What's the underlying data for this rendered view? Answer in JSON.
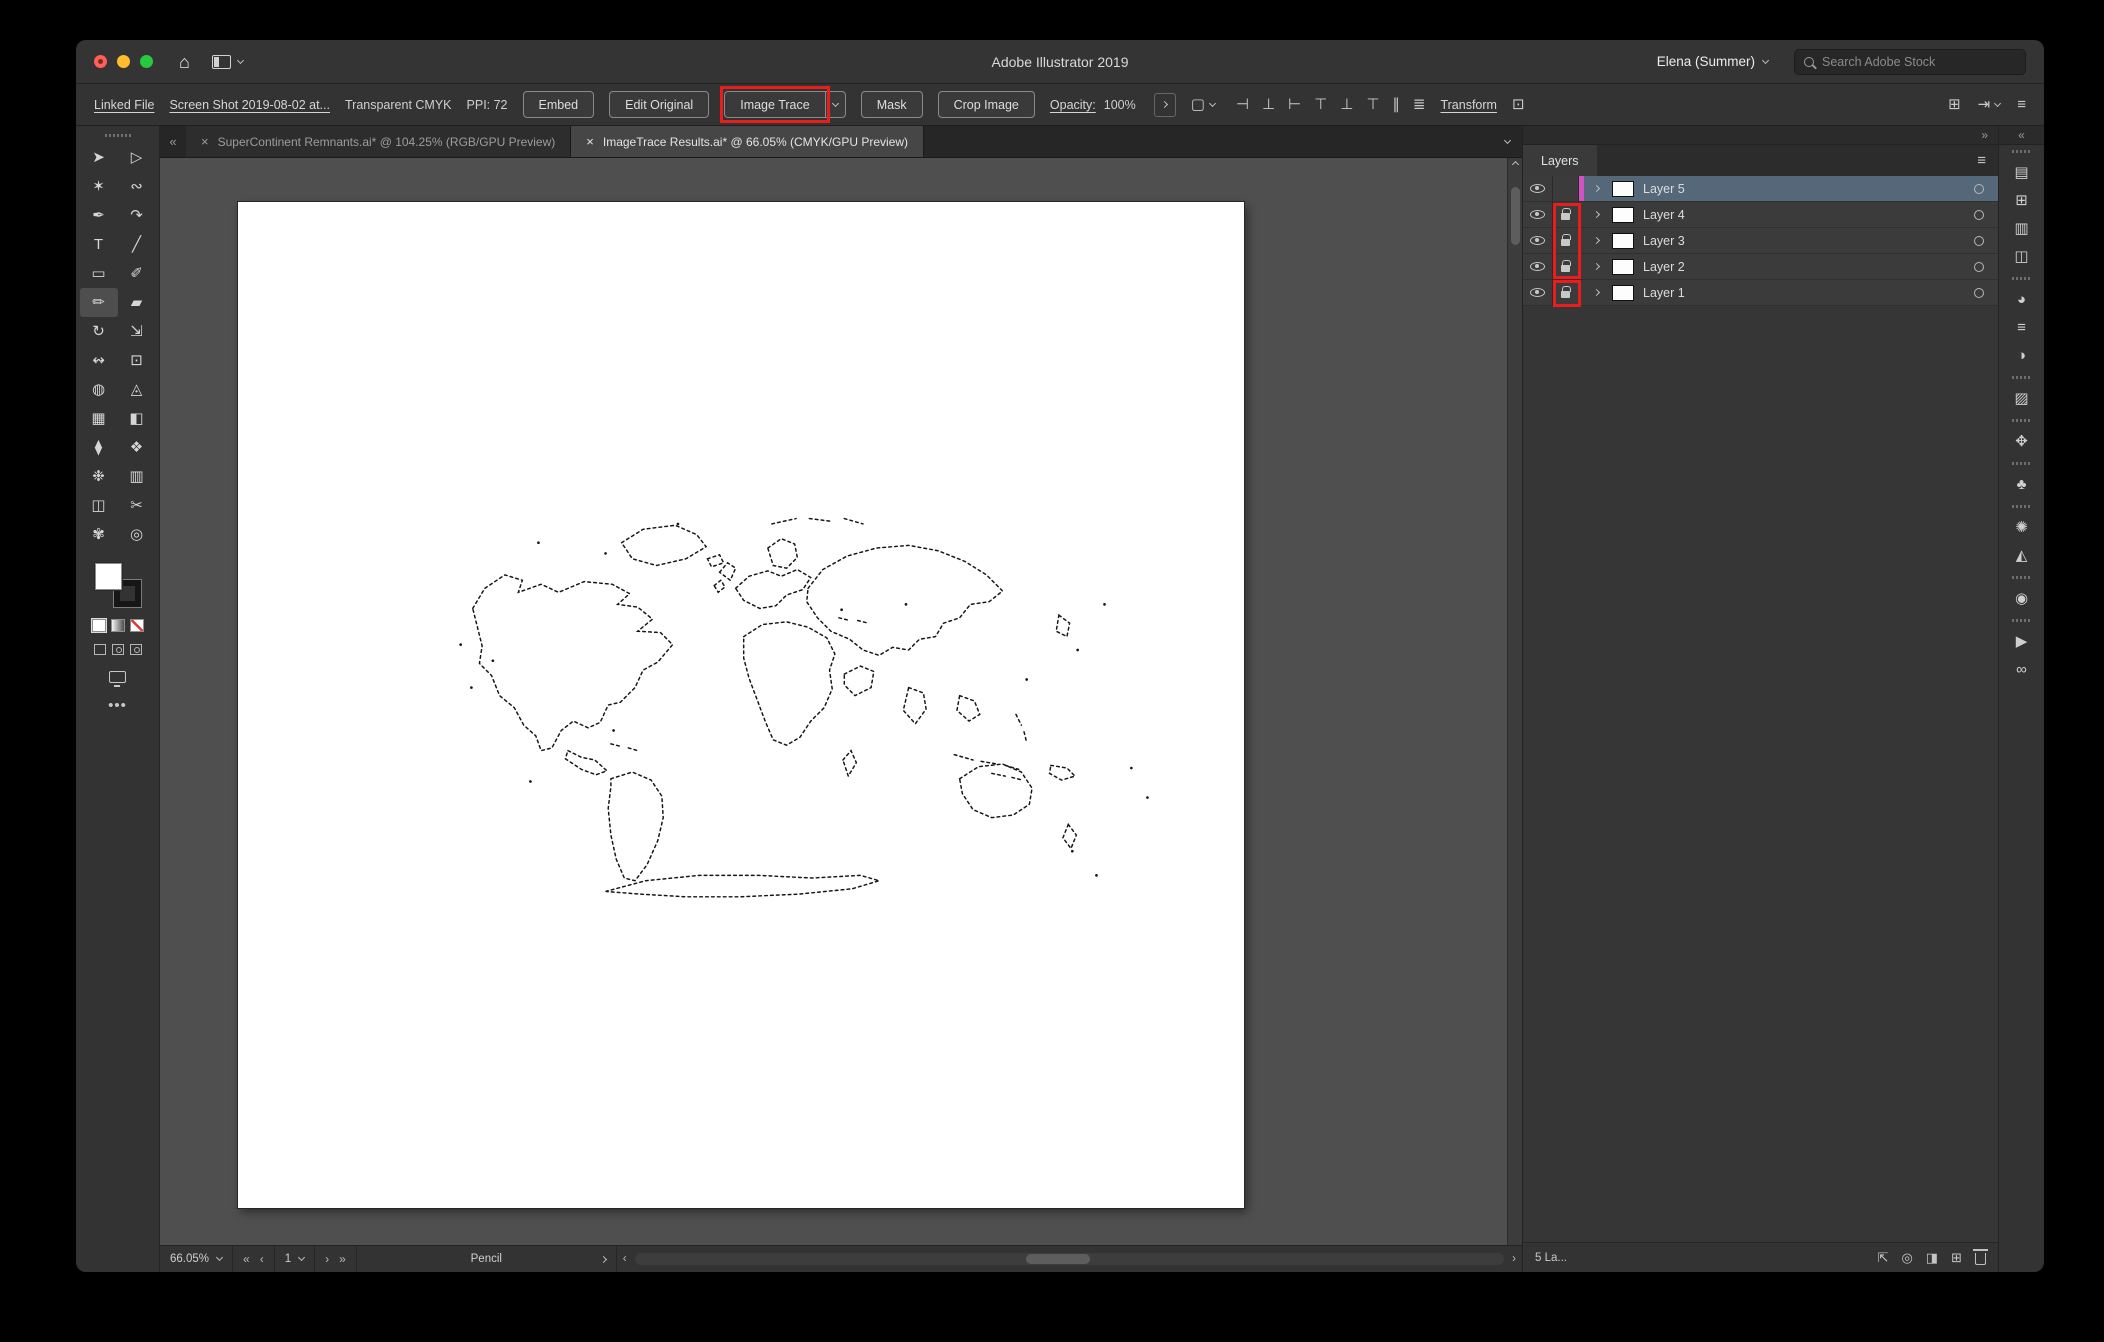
{
  "colors": {
    "annotation_red": "#ea1d1d",
    "selected_layer_row": "#54687a",
    "layer_color_indicator": "#d052c4",
    "canvas_background": "#4f4f4f",
    "artboard": "#ffffff"
  },
  "icons": {
    "close_tab": "×",
    "home": "⌂",
    "hamburger": "≡",
    "ellipsis": "•••",
    "first": "«",
    "previous": "‹",
    "next": "›",
    "last": "»",
    "double_left": "«",
    "double_right": "»",
    "grid": "⊞",
    "share": "⇥",
    "style_box": "▢",
    "fit": "⊡",
    "export": "⇱",
    "locate": "◎",
    "clip_mask": "◨",
    "new_layer": "⊞"
  },
  "titlebar": {
    "app_title": "Adobe Illustrator 2019",
    "account_name": "Elena (Summer)",
    "search_placeholder": "Search Adobe Stock"
  },
  "control_bar": {
    "linked_file_label": "Linked File",
    "file_name": "Screen Shot 2019-08-02 at...",
    "color_info": "Transparent CMYK",
    "ppi": "PPI: 72",
    "buttons": {
      "embed": "Embed",
      "edit_original": "Edit Original",
      "image_trace": "Image Trace",
      "mask": "Mask",
      "crop_image": "Crop Image"
    },
    "opacity_label": "Opacity:",
    "opacity_value": "100%",
    "transform_label": "Transform",
    "align_icons": [
      {
        "name": "align-horizontal-left-icon",
        "glyph": "⊣"
      },
      {
        "name": "align-horizontal-center-icon",
        "glyph": "⊥"
      },
      {
        "name": "align-horizontal-right-icon",
        "glyph": "⊢"
      },
      {
        "name": "align-vertical-top-icon",
        "glyph": "⊤"
      },
      {
        "name": "align-vertical-center-icon",
        "glyph": "⊥"
      },
      {
        "name": "align-vertical-bottom-icon",
        "glyph": "⊤"
      },
      {
        "name": "distribute-horizontal-icon",
        "glyph": "∥"
      },
      {
        "name": "distribute-vertical-icon",
        "glyph": "≣"
      }
    ]
  },
  "document_tabs": [
    {
      "label": "SuperContinent Remnants.ai* @ 104.25% (RGB/GPU Preview)"
    },
    {
      "label": "ImageTrace Results.ai* @ 66.05% (CMYK/GPU Preview)",
      "active": true
    }
  ],
  "toolbar": {
    "tools": [
      {
        "name": "selection-tool",
        "glyph": "➤"
      },
      {
        "name": "direct-selection-tool",
        "glyph": "▷"
      },
      {
        "name": "magic-wand-tool",
        "glyph": "✶"
      },
      {
        "name": "lasso-tool",
        "glyph": "∾"
      },
      {
        "name": "pen-tool",
        "glyph": "✒"
      },
      {
        "name": "curvature-tool",
        "glyph": "↷"
      },
      {
        "name": "type-tool",
        "glyph": "T"
      },
      {
        "name": "line-segment-tool",
        "glyph": "╱"
      },
      {
        "name": "rectangle-tool",
        "glyph": "▭"
      },
      {
        "name": "paintbrush-tool",
        "glyph": "✐"
      },
      {
        "name": "pencil-tool",
        "glyph": "✏",
        "selected": true
      },
      {
        "name": "eraser-tool",
        "glyph": "▰"
      },
      {
        "name": "rotate-tool",
        "glyph": "↻"
      },
      {
        "name": "scale-tool",
        "glyph": "⇲"
      },
      {
        "name": "width-tool",
        "glyph": "↭"
      },
      {
        "name": "free-transform-tool",
        "glyph": "⊡"
      },
      {
        "name": "shape-builder-tool",
        "glyph": "◍"
      },
      {
        "name": "perspective-grid-tool",
        "glyph": "◬"
      },
      {
        "name": "mesh-tool",
        "glyph": "▦"
      },
      {
        "name": "gradient-tool",
        "glyph": "◧"
      },
      {
        "name": "eyedropper-tool",
        "glyph": "⧫"
      },
      {
        "name": "blend-tool",
        "glyph": "❖"
      },
      {
        "name": "symbol-sprayer-tool",
        "glyph": "❉"
      },
      {
        "name": "column-graph-tool",
        "glyph": "▥"
      },
      {
        "name": "artboard-tool",
        "glyph": "◫"
      },
      {
        "name": "slice-tool",
        "glyph": "✂"
      },
      {
        "name": "hand-tool",
        "glyph": "✾"
      },
      {
        "name": "zoom-tool",
        "glyph": "◎"
      }
    ]
  },
  "status_bar": {
    "zoom_value": "66.05%",
    "artboard_number": "1",
    "tool_name": "Pencil"
  },
  "layers_panel": {
    "panel_title": "Layers",
    "layers": [
      {
        "name": "Layer 5",
        "selected": true,
        "locked": false
      },
      {
        "name": "Layer 4",
        "locked": true
      },
      {
        "name": "Layer 3",
        "locked": true
      },
      {
        "name": "Layer 2",
        "locked": true
      },
      {
        "name": "Layer 1",
        "locked": true
      }
    ],
    "footer_text": "5 La..."
  },
  "right_strip": {
    "groups": [
      {
        "icons": [
          {
            "name": "swatches-panel-icon",
            "glyph": "▤"
          },
          {
            "name": "color-panel-icon",
            "glyph": "⊞"
          },
          {
            "name": "graphic-styles-panel-icon",
            "glyph": "▥"
          },
          {
            "name": "symbols-panel-icon",
            "glyph": "◫"
          }
        ]
      },
      {
        "icons": [
          {
            "name": "brushes-panel-icon",
            "glyph": "◕"
          },
          {
            "name": "stroke-panel-icon",
            "glyph": "≡"
          },
          {
            "name": "gradient-panel-icon",
            "glyph": "◑"
          }
        ]
      },
      {
        "icons": [
          {
            "name": "transparency-panel-icon",
            "glyph": "▨"
          }
        ]
      },
      {
        "icons": [
          {
            "name": "appearance-panel-icon",
            "glyph": "✥"
          }
        ]
      },
      {
        "icons": [
          {
            "name": "pattern-options-panel-icon",
            "glyph": "♣"
          }
        ]
      },
      {
        "icons": [
          {
            "name": "color-guide-panel-icon",
            "glyph": "✺"
          },
          {
            "name": "shape-panel-icon",
            "glyph": "◭"
          }
        ]
      },
      {
        "icons": [
          {
            "name": "color-themes-panel-icon",
            "glyph": "◉"
          }
        ]
      },
      {
        "icons": [
          {
            "name": "actions-panel-icon",
            "glyph": "▶"
          },
          {
            "name": "links-panel-icon",
            "glyph": "∞"
          }
        ]
      }
    ]
  }
}
